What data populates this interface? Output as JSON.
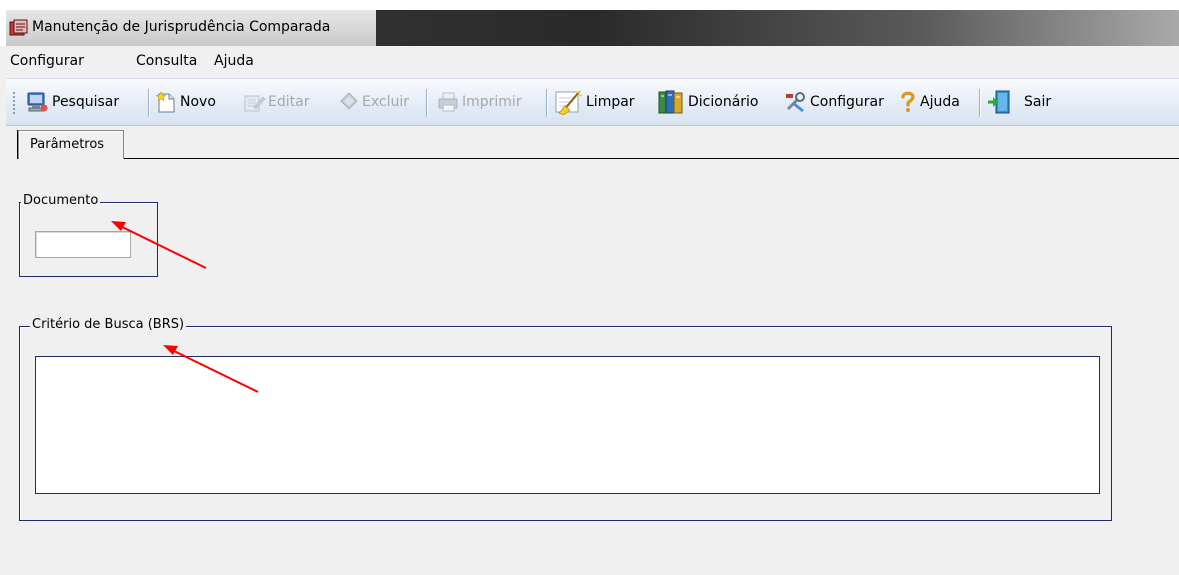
{
  "window": {
    "title": "Manutenção de Jurisprudência  Comparada"
  },
  "menu": {
    "items": [
      {
        "label": "Configurar"
      },
      {
        "label": "Consulta"
      },
      {
        "label": "Ajuda"
      }
    ]
  },
  "toolbar": {
    "search_label": "Pesquisar",
    "new_label": "Novo",
    "edit_label": "Editar",
    "delete_label": "Excluir",
    "print_label": "Imprimir",
    "clear_label": "Limpar",
    "dictionary_label": "Dicionário",
    "configure_label": "Configurar",
    "help_label": "Ajuda",
    "exit_label": "Sair",
    "disabled_items": [
      "Editar",
      "Excluir",
      "Imprimir"
    ]
  },
  "tabs": [
    {
      "label": "Parâmetros",
      "active": true
    }
  ],
  "form": {
    "document_group_label": "Documento",
    "document_value": "",
    "criteria_group_label": "Critério de Busca (BRS)",
    "criteria_value": ""
  },
  "annotations": {
    "arrow_color": "#ff0000",
    "arrow_count": 2
  },
  "colors": {
    "group_border": "#1f2a6b",
    "window_background": "#f0f0f0"
  }
}
